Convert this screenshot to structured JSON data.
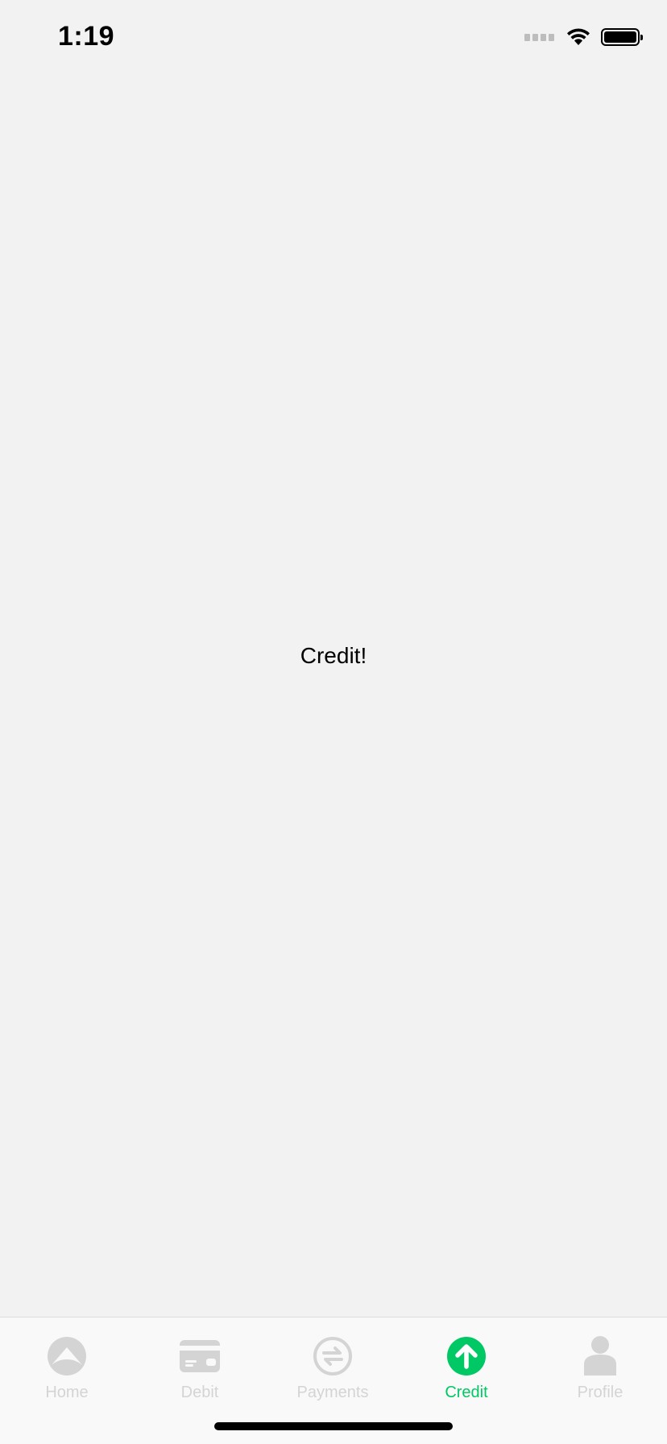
{
  "status_bar": {
    "time": "1:19"
  },
  "content": {
    "label": "Credit!"
  },
  "tab_bar": {
    "active_color": "#00c864",
    "inactive_color": "#d4d4d4",
    "tabs": [
      {
        "label": "Home",
        "icon": "home-icon",
        "active": false
      },
      {
        "label": "Debit",
        "icon": "debit-card-icon",
        "active": false
      },
      {
        "label": "Payments",
        "icon": "payments-exchange-icon",
        "active": false
      },
      {
        "label": "Credit",
        "icon": "credit-arrow-up-icon",
        "active": true
      },
      {
        "label": "Profile",
        "icon": "profile-icon",
        "active": false
      }
    ]
  }
}
